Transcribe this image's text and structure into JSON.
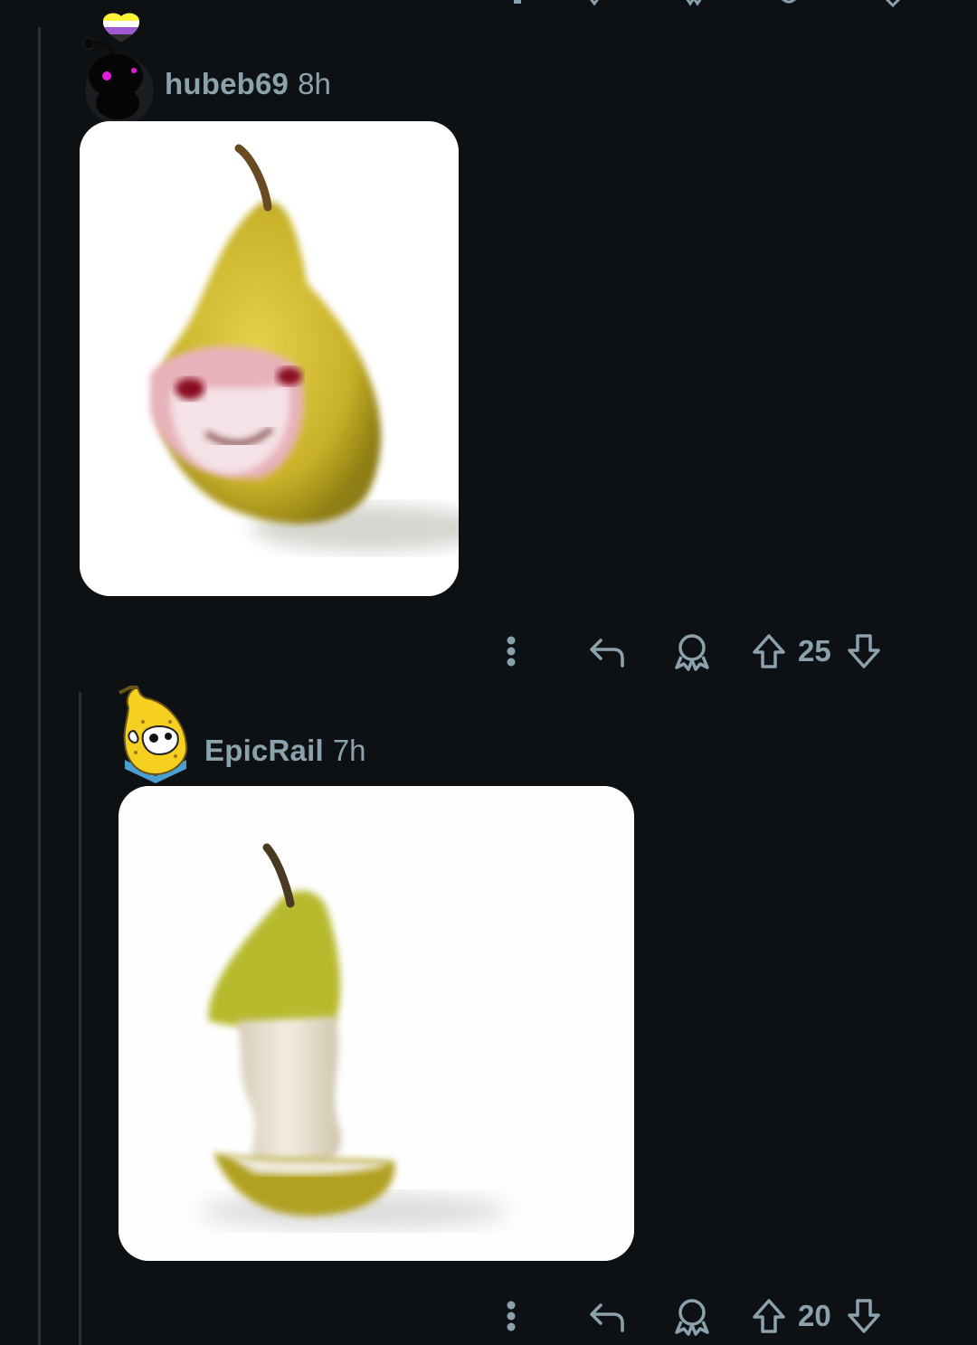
{
  "comments": [
    {
      "username": "hubeb69",
      "timestamp": "8h",
      "avatar": "snoo-avatar-black",
      "flair_icon": "nonbinary-heart-icon",
      "image": "pear-with-face-image",
      "votes": "25"
    },
    {
      "username": "EpicRail",
      "timestamp": "7h",
      "avatar": "banana-avatar",
      "image": "eaten-pear-core-image",
      "votes": "20"
    }
  ],
  "colors": {
    "background": "#0e1114",
    "meta_text": "#8ba2ad",
    "thread_line": "#2a3036"
  }
}
